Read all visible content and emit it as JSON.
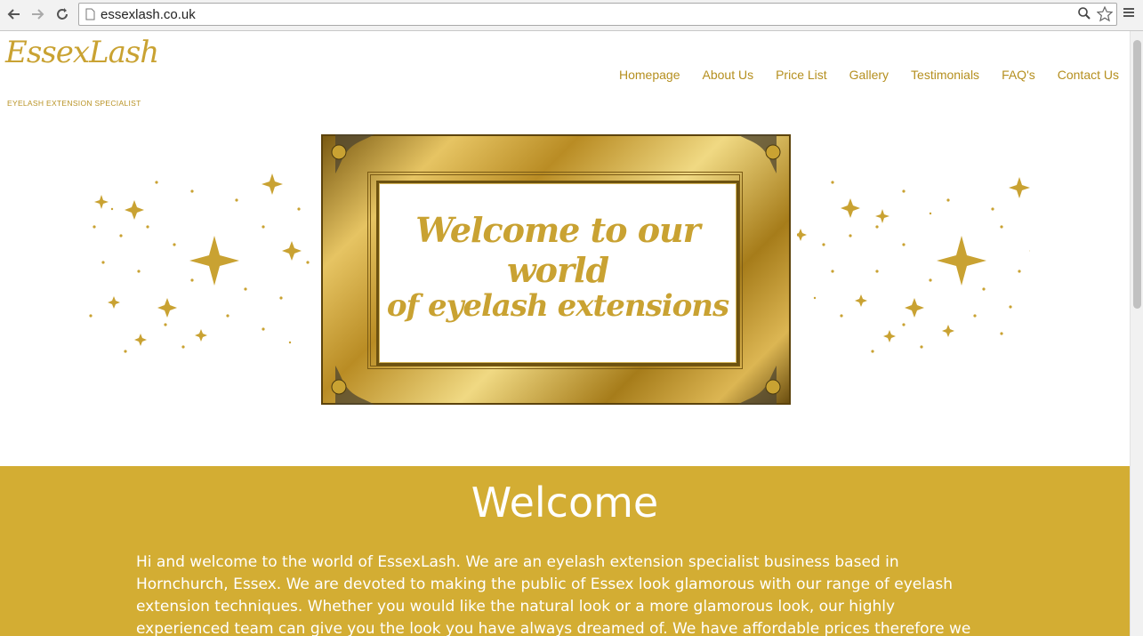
{
  "browser": {
    "url": "essexlash.co.uk",
    "back_icon": "back-arrow-icon",
    "forward_icon": "forward-arrow-icon",
    "reload_icon": "reload-icon",
    "zoom_icon": "magnifier-icon",
    "bookmark_icon": "star-icon",
    "menu_icon": "hamburger-menu-icon"
  },
  "site": {
    "logo_text": "EssexLash",
    "logo_sub": "EYELASH  EXTENSION  SPECIALIST",
    "nav": [
      "Homepage",
      "About Us",
      "Price List",
      "Gallery",
      "Testimonials",
      "FAQ's",
      "Contact Us"
    ],
    "hero": {
      "line1": "Welcome to our world",
      "line2": "of eyelash extensions"
    },
    "welcome": {
      "title": "Welcome",
      "text": "Hi and welcome to the world of EssexLash. We are an eyelash extension specialist business based in Hornchurch, Essex. We are devoted to making the public of Essex look glamorous with our range of eyelash extension techniques. Whether you would like the natural look or a more glamorous look, our highly experienced team can give you the look you have always dreamed of. We have affordable prices therefore we have a range of wide clientele including Towie celebs."
    }
  },
  "colors": {
    "gold": "#d3ad33",
    "nav_text": "#b58f1f",
    "white": "#ffffff"
  }
}
